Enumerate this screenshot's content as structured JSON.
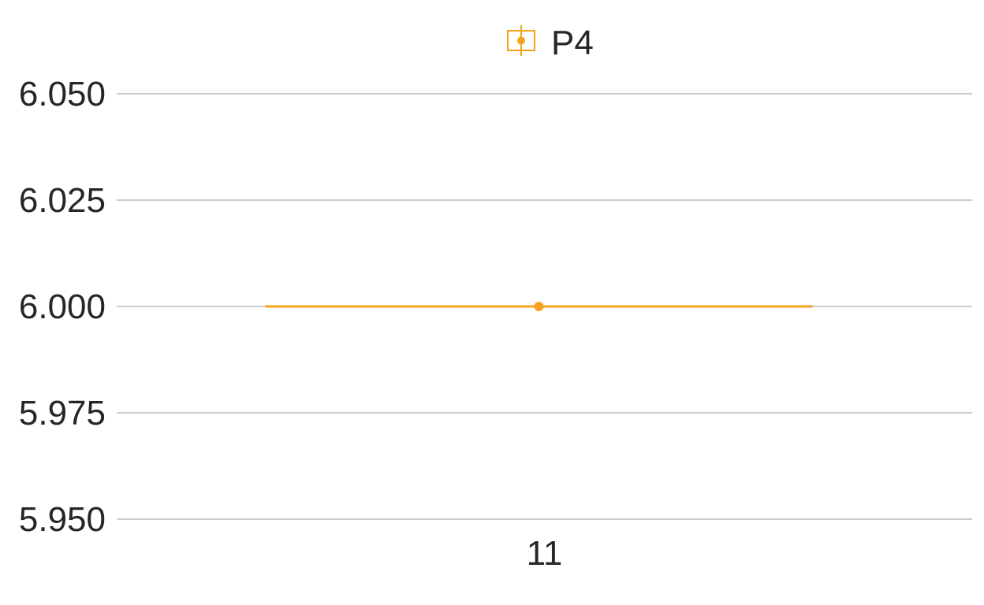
{
  "chart_data": {
    "type": "box",
    "categories": [
      "11"
    ],
    "series": [
      {
        "name": "P4",
        "color": "#f5a31a",
        "boxes": [
          {
            "category": "11",
            "min": 6.0,
            "q1": 6.0,
            "median": 6.0,
            "q3": 6.0,
            "max": 6.0,
            "mean": 6.0
          }
        ]
      }
    ],
    "yticks": [
      "5.950",
      "5.975",
      "6.000",
      "6.025",
      "6.050"
    ],
    "ylim": [
      5.95,
      6.05
    ],
    "grid": true,
    "legend_position": "top-center",
    "grid_color": "#cccccc",
    "text_color": "#262626"
  }
}
